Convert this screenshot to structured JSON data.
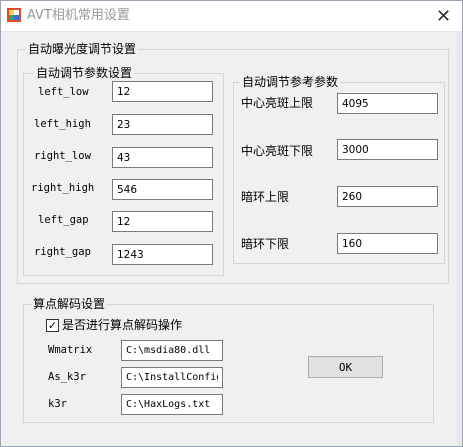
{
  "window": {
    "title": "AVT相机常用设置",
    "close_glyph": "✕"
  },
  "auto_exposure": {
    "title": "自动曝光度调节设置",
    "params_group": {
      "title": "自动调节参数设置",
      "fields": [
        {
          "label": "left_low",
          "value": "12"
        },
        {
          "label": "left_high",
          "value": "23"
        },
        {
          "label": "right_low",
          "value": "43"
        },
        {
          "label": "right_high",
          "value": "546"
        },
        {
          "label": "left_gap",
          "value": "12"
        },
        {
          "label": "right_gap",
          "value": "1243"
        }
      ]
    },
    "ref_group": {
      "title": "自动调节参考参数",
      "fields": [
        {
          "label": "中心亮斑上限",
          "value": "4095"
        },
        {
          "label": "中心亮斑下限",
          "value": "3000"
        },
        {
          "label": "暗环上限",
          "value": "260"
        },
        {
          "label": "暗环下限",
          "value": "160"
        }
      ]
    }
  },
  "decode": {
    "title": "算点解码设置",
    "checkbox": {
      "label": "是否进行算点解码操作",
      "checked": true,
      "mark": "✓"
    },
    "fields": [
      {
        "label": "Wmatrix",
        "value": "C:\\msdia80.dll"
      },
      {
        "label": "As_k3r",
        "value": "C:\\InstallConfig"
      },
      {
        "label": "k3r",
        "value": "C:\\HaxLogs.txt"
      }
    ]
  },
  "ok_button": {
    "label": "OK"
  }
}
